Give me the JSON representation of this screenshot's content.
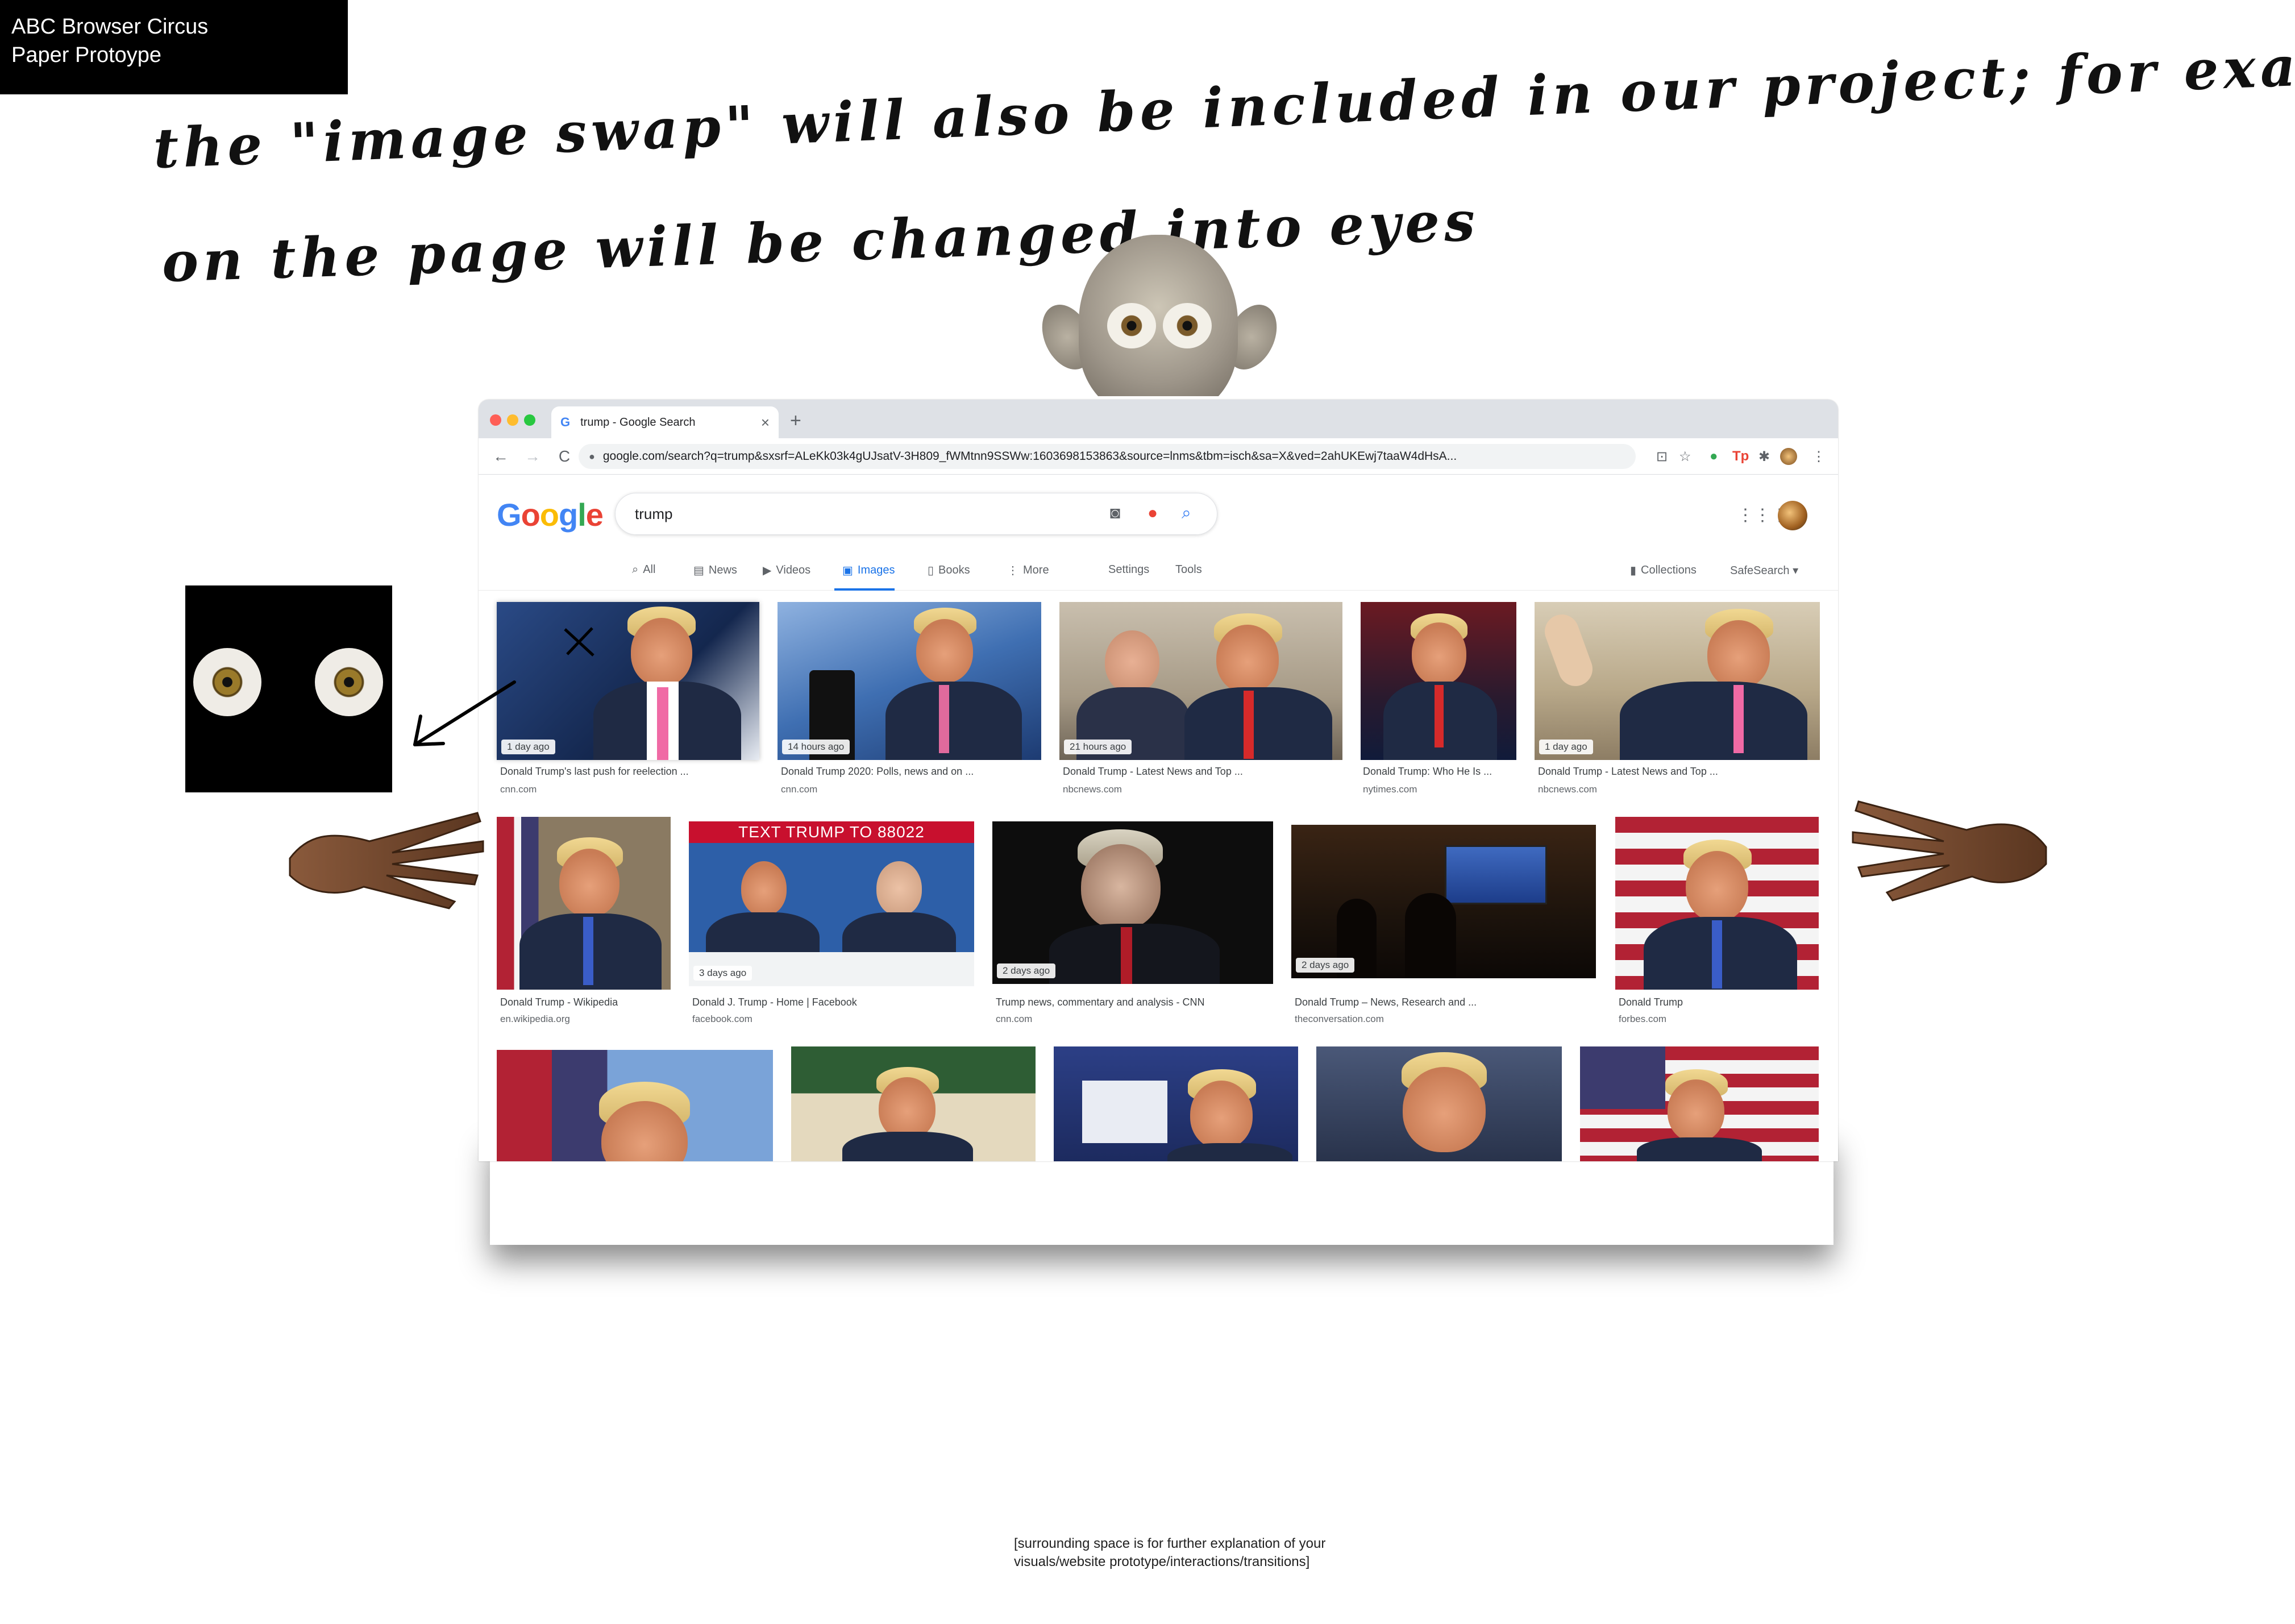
{
  "slide": {
    "title_line1": "ABC Browser Circus",
    "title_line2": "Paper Protoype",
    "handwriting_line1": "the \"image swap\" will also be included in our project; for example, all the pictures",
    "handwriting_line2": "on the page will be changed into eyes",
    "footer_line1": "[surrounding space is for further explanation of your",
    "footer_line2": "visuals/website prototype/interactions/transitions]"
  },
  "browser": {
    "tab_title": "trump - Google Search",
    "tab_close": "×",
    "new_tab": "+",
    "url": "google.com/search?q=trump&sxsrf=ALeKk03k4gUJsatV-3H809_fWMtnn9SSWw:1603698153863&source=lnms&tbm=isch&sa=X&ved=2ahUKEwj7taaW4dHsA...",
    "back": "←",
    "forward": "→",
    "reload": "C"
  },
  "google": {
    "logo_letters": [
      "G",
      "o",
      "o",
      "g",
      "l",
      "e"
    ],
    "query": "trump",
    "nav": [
      {
        "icon": "search-icon",
        "glyph": "⌕",
        "label": "All"
      },
      {
        "icon": "news-icon",
        "glyph": "▤",
        "label": "News"
      },
      {
        "icon": "video-icon",
        "glyph": "▶",
        "label": "Videos"
      },
      {
        "icon": "image-icon",
        "glyph": "▣",
        "label": "Images",
        "active": true
      },
      {
        "icon": "book-icon",
        "glyph": "▯",
        "label": "Books"
      },
      {
        "icon": "more-icon",
        "glyph": "⋮",
        "label": "More"
      },
      {
        "label": "Settings"
      },
      {
        "label": "Tools"
      },
      {
        "icon": "collections-icon",
        "glyph": "▮",
        "label": "Collections"
      },
      {
        "label": "SafeSearch ▾"
      }
    ]
  },
  "results": [
    {
      "age": "1 day ago",
      "title": "Donald Trump's last push for reelection ...",
      "source": "cnn.com"
    },
    {
      "age": "14 hours ago",
      "title": "Donald Trump 2020: Polls, news and on ...",
      "source": "cnn.com"
    },
    {
      "age": "21 hours ago",
      "title": "Donald Trump - Latest News and Top ...",
      "source": "nbcnews.com"
    },
    {
      "age": "",
      "title": "Donald Trump: Who He Is ...",
      "source": "nytimes.com"
    },
    {
      "age": "1 day ago",
      "title": "Donald Trump - Latest News and Top ...",
      "source": "nbcnews.com"
    },
    {
      "age": "",
      "title": "Donald Trump - Wikipedia",
      "source": "en.wikipedia.org"
    },
    {
      "age": "3 days ago",
      "title": "Donald J. Trump - Home | Facebook",
      "source": "facebook.com"
    },
    {
      "age": "2 days ago",
      "title": "Trump news, commentary and analysis - CNN",
      "source": "cnn.com"
    },
    {
      "age": "2 days ago",
      "title": "Donald Trump – News, Research and ...",
      "source": "theconversation.com"
    },
    {
      "age": "",
      "title": "Donald Trump",
      "source": "forbes.com"
    }
  ],
  "banner_text": "TEXT TRUMP TO 88022",
  "colors": {
    "google_blue": "#4285f4",
    "google_red": "#ea4335",
    "google_yellow": "#fbbc05",
    "google_green": "#34a853",
    "active_tab": "#1a73e8"
  }
}
